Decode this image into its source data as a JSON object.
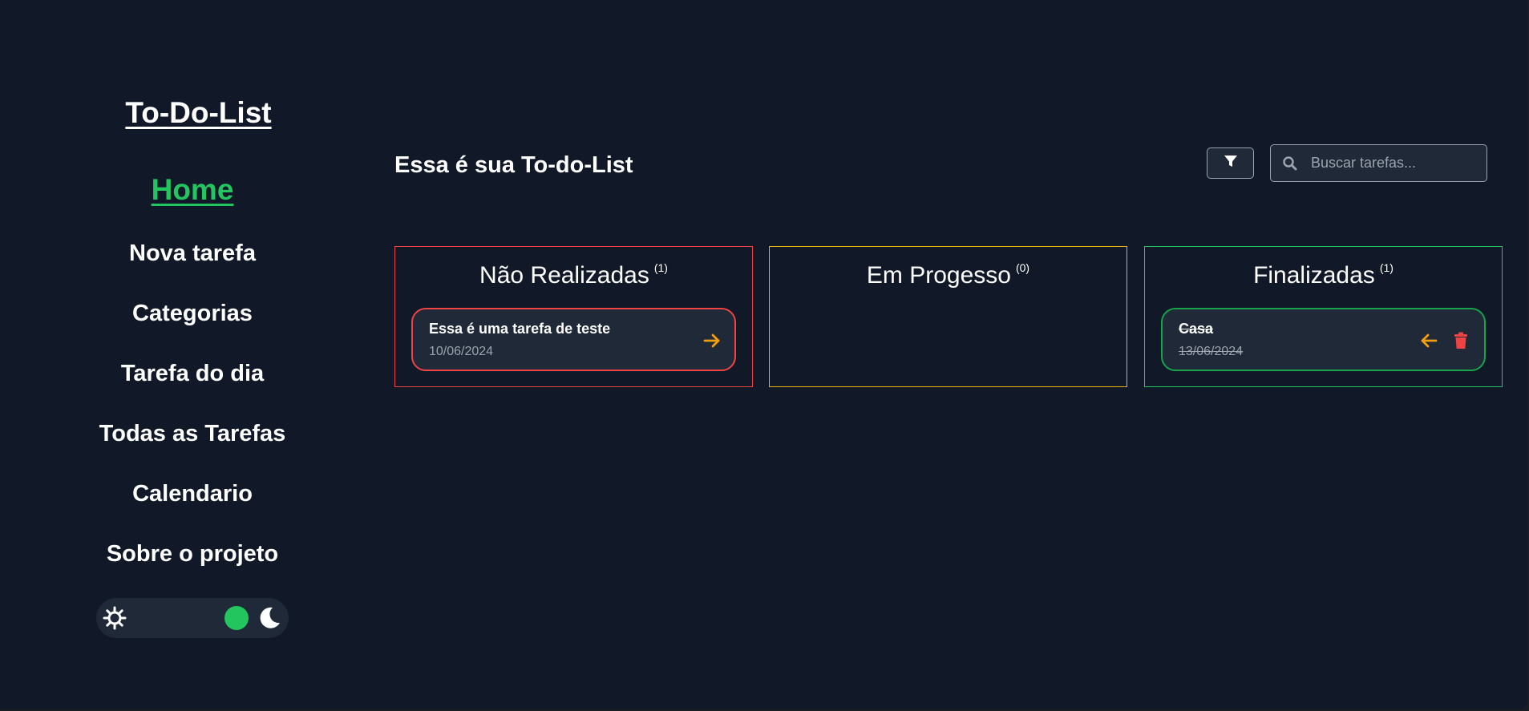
{
  "sidebar": {
    "brand": "To-Do-List",
    "items": [
      {
        "label": "Home",
        "active": true
      },
      {
        "label": "Nova tarefa"
      },
      {
        "label": "Categorias"
      },
      {
        "label": "Tarefa do dia"
      },
      {
        "label": "Todas as Tarefas"
      },
      {
        "label": "Calendario"
      },
      {
        "label": "Sobre o projeto"
      }
    ],
    "theme_toggle": {
      "left_icon": "sun-icon",
      "right_icon": "moon-icon",
      "mode": "dark"
    }
  },
  "header": {
    "title": "Essa é sua To-do-List",
    "filter_icon": "filter-icon",
    "search": {
      "placeholder": "Buscar tarefas...",
      "value": "",
      "icon": "search-icon"
    }
  },
  "columns": [
    {
      "title": "Não Realizadas",
      "count": "(1)",
      "border_color": "#ef4444",
      "tasks": [
        {
          "title": "Essa é uma tarefa de teste",
          "date": "10/06/2024",
          "action_icon": "arrow-right-icon"
        }
      ]
    },
    {
      "title": "Em Progesso",
      "count": "(0)",
      "border_color": "#eab308",
      "tasks": []
    },
    {
      "title": "Finalizadas",
      "count": "(1)",
      "border_color": "#22c55e",
      "tasks": [
        {
          "title": "Casa",
          "date": "13/06/2024",
          "action_icon": "arrow-left-icon",
          "delete_icon": "trash-icon"
        }
      ]
    }
  ],
  "colors": {
    "background": "#111827",
    "accent_green": "#22c55e",
    "card_bg": "#1f2937",
    "arrow_orange": "#f59e0b",
    "trash_red": "#ef4444"
  }
}
